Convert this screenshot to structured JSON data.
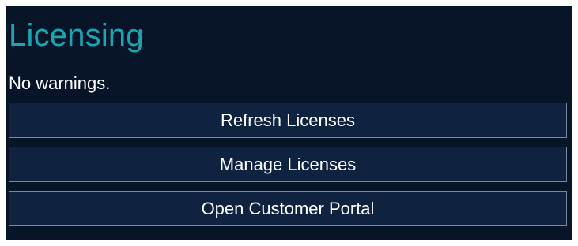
{
  "licensing": {
    "title": "Licensing",
    "status_text": "No warnings.",
    "buttons": {
      "refresh": "Refresh Licenses",
      "manage": "Manage Licenses",
      "portal": "Open Customer Portal"
    }
  },
  "colors": {
    "background": "#081428",
    "title": "#1aa6b0",
    "button_background": "#0f2240",
    "button_border": "#7b8798",
    "text": "#ffffff"
  }
}
